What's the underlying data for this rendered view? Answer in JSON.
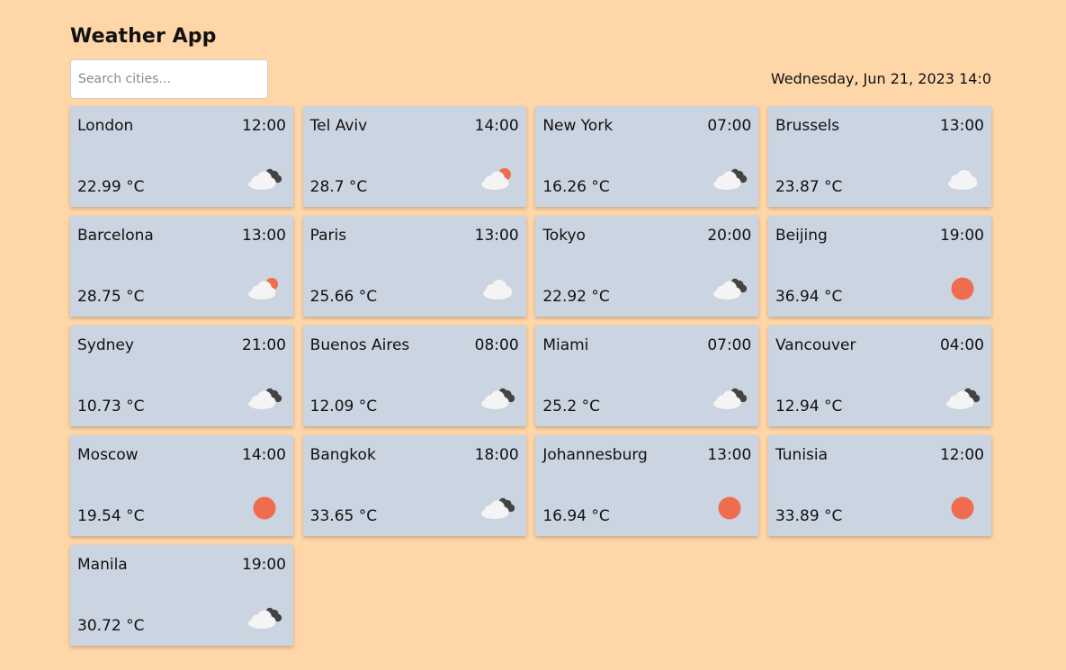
{
  "app": {
    "title": "Weather App"
  },
  "search": {
    "placeholder": "Search cities..."
  },
  "header": {
    "datetime": "Wednesday, Jun 21, 2023 14:0"
  },
  "colors": {
    "background": "#fed6a8",
    "card": "#cbd4e1",
    "sun": "#ef6c4f",
    "cloud": "#f4f4f4",
    "dark_cloud": "#444444"
  },
  "cities": [
    {
      "name": "London",
      "time": "12:00",
      "temp": "22.99 °C",
      "icon": "broken-clouds-icon"
    },
    {
      "name": "Tel Aviv",
      "time": "14:00",
      "temp": "28.7 °C",
      "icon": "partly-sunny-icon"
    },
    {
      "name": "New York",
      "time": "07:00",
      "temp": "16.26 °C",
      "icon": "broken-clouds-icon"
    },
    {
      "name": "Brussels",
      "time": "13:00",
      "temp": "23.87 °C",
      "icon": "cloud-icon"
    },
    {
      "name": "Barcelona",
      "time": "13:00",
      "temp": "28.75 °C",
      "icon": "partly-sunny-icon"
    },
    {
      "name": "Paris",
      "time": "13:00",
      "temp": "25.66 °C",
      "icon": "cloud-icon"
    },
    {
      "name": "Tokyo",
      "time": "20:00",
      "temp": "22.92 °C",
      "icon": "broken-clouds-icon"
    },
    {
      "name": "Beijing",
      "time": "19:00",
      "temp": "36.94 °C",
      "icon": "sun-icon"
    },
    {
      "name": "Sydney",
      "time": "21:00",
      "temp": "10.73 °C",
      "icon": "broken-clouds-icon"
    },
    {
      "name": "Buenos Aires",
      "time": "08:00",
      "temp": "12.09 °C",
      "icon": "broken-clouds-icon"
    },
    {
      "name": "Miami",
      "time": "07:00",
      "temp": "25.2 °C",
      "icon": "broken-clouds-icon"
    },
    {
      "name": "Vancouver",
      "time": "04:00",
      "temp": "12.94 °C",
      "icon": "broken-clouds-icon"
    },
    {
      "name": "Moscow",
      "time": "14:00",
      "temp": "19.54 °C",
      "icon": "sun-icon"
    },
    {
      "name": "Bangkok",
      "time": "18:00",
      "temp": "33.65 °C",
      "icon": "broken-clouds-icon"
    },
    {
      "name": "Johannesburg",
      "time": "13:00",
      "temp": "16.94 °C",
      "icon": "sun-icon"
    },
    {
      "name": "Tunisia",
      "time": "12:00",
      "temp": "33.89 °C",
      "icon": "sun-icon"
    },
    {
      "name": "Manila",
      "time": "19:00",
      "temp": "30.72 °C",
      "icon": "broken-clouds-icon"
    }
  ]
}
